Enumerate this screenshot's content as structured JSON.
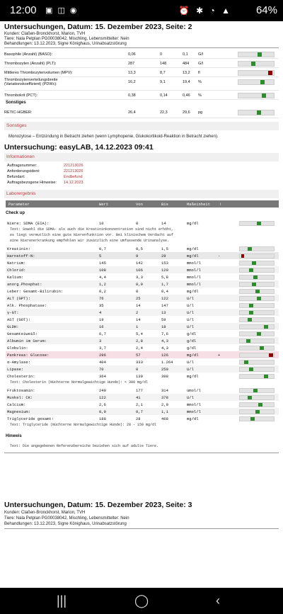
{
  "status": {
    "time": "12:00",
    "battery": "64%"
  },
  "page1": {
    "title": "Untersuchungen, Datum: 15. Dezember 2023, Seite: 2",
    "lines": [
      "Kunden: Claßen-Bronckhorst, Marion, TVH",
      "Tiere: Nala Petplan PG00038042, Mischling, Lebensmittelter: Nein",
      "Behandlungen: 13.12.2023, Signe Könighaus, Urinabsatzstörung"
    ]
  },
  "hema_rows": [
    {
      "name": "Basophile (Anzahl) (BASO):",
      "value": "0,06",
      "low": "0",
      "high": "0,1",
      "unit": "G/l",
      "marker": 0.62,
      "kind": "ok"
    },
    {
      "name": "Thrombozyten (Anzahl) (PLT):",
      "value": "287",
      "low": "148",
      "high": "484",
      "unit": "G/l",
      "marker": 0.42,
      "kind": "ok"
    },
    {
      "name": "Mittleres Thrombozytenvolumen (MPV):",
      "value": "13,3",
      "low": "8,7",
      "high": "13,2",
      "unit": "fl",
      "marker": 0.95,
      "kind": "hi"
    },
    {
      "name": "Thrombozytenverteilungsbreite (Variationskoeffizient) (PDWc):",
      "value": "16,2",
      "low": "9,1",
      "high": "19,4",
      "unit": "%",
      "marker": 0.7,
      "kind": "ok"
    },
    {
      "name": "Thrombokrit (PCT):",
      "value": "0,38",
      "low": "0,14",
      "high": "0,46",
      "unit": "%",
      "marker": 0.75,
      "kind": "ok"
    }
  ],
  "sonstiges_label": "Sonstiges",
  "retic": {
    "name": "RETIC-HGBER:",
    "value": "26,4",
    "low": "22,3",
    "high": "29,6",
    "unit": "pg",
    "marker": 0.6,
    "kind": "ok"
  },
  "sonstiges_band": "Sonstiges",
  "sonstiges_text": "Monozytose – Entzündung in Betracht ziehen (wenn Lymphopenie, Glukokortikoid-Reaktion in Betracht ziehen).",
  "easylab_title": "Untersuchung: easyLAB, 14.12.2023 09:41",
  "informationen_band": "Informationen",
  "info": [
    {
      "k": "Auftragsnummer:",
      "v": "221213026"
    },
    {
      "k": "Anforderungsident:",
      "v": "221213026"
    },
    {
      "k": "Befundart:",
      "v": "Endbefund"
    },
    {
      "k": "Auftragsbezogene Hinweise:",
      "v": "14.12.2023"
    }
  ],
  "laborergebnis_band": "Laborergebnis",
  "lab_head": {
    "param": "Parameter",
    "wert": "Wert",
    "von": "Von",
    "bis": "Bis",
    "einheit": "Maßeinheit",
    "flag": "!"
  },
  "checkup_label": "Check up",
  "lab_rows_a": [
    {
      "name": "Niere: SDMA (EIA):",
      "value": "10",
      "low": "0",
      "high": "14",
      "unit": "mg/dl",
      "marker": 0.55,
      "kind": "ok",
      "style": ""
    }
  ],
  "sdma_note": [
    "Text:  Sowohl die SDMA- als auch die Kreatininkonzentration sind nicht erhöht,",
    "es liegt vermutlich eine gute Nierenfunktion vor. Bei klinischem Verdacht auf",
    "eine Nierenerkrankung empfehlen wir zusätzlich eine umfassende Urinanalyse."
  ],
  "lab_rows_b": [
    {
      "name": "Kreatinin:",
      "value": "0,7",
      "low": "0,5",
      "high": "1,5",
      "unit": "mg/dl",
      "marker": 0.25,
      "kind": "ok",
      "style": ""
    },
    {
      "name": "Harnstoff-N:",
      "value": "5",
      "low": "9",
      "high": "29",
      "unit": "mg/dl",
      "flag": "-",
      "marker": 0.04,
      "kind": "lo",
      "style": "flag"
    },
    {
      "name": "Natrium:",
      "value": "145",
      "low": "142",
      "high": "153",
      "unit": "mmol/l",
      "marker": 0.4,
      "kind": "ok",
      "style": ""
    },
    {
      "name": "Chlorid:",
      "value": "108",
      "low": "106",
      "high": "120",
      "unit": "mmol/l",
      "marker": 0.3,
      "kind": "ok",
      "style": "alt"
    },
    {
      "name": "Kalium:",
      "value": "4,4",
      "low": "3,3",
      "high": "5,8",
      "unit": "mmol/l",
      "marker": 0.45,
      "kind": "ok",
      "style": ""
    },
    {
      "name": "anorg.Phosphat:",
      "value": "1,2",
      "low": "0,9",
      "high": "1,7",
      "unit": "mmol/l",
      "marker": 0.4,
      "kind": "ok",
      "style": "alt"
    },
    {
      "name": "Leber: Gesamt-Bilirubin:",
      "value": "0,2",
      "low": "0",
      "high": "0,4",
      "unit": "mg/dl",
      "marker": 0.5,
      "kind": "ok",
      "style": ""
    },
    {
      "name": "ALT (GPT):",
      "value": "76",
      "low": "25",
      "high": "122",
      "unit": "U/l",
      "marker": 0.55,
      "kind": "ok",
      "style": "alt"
    },
    {
      "name": "Alk. Phosphatase:",
      "value": "35",
      "low": "14",
      "high": "147",
      "unit": "U/l",
      "marker": 0.3,
      "kind": "ok",
      "style": ""
    },
    {
      "name": "γ-GT:",
      "value": "4",
      "low": "2",
      "high": "13",
      "unit": "U/l",
      "marker": 0.3,
      "kind": "ok",
      "style": "alt"
    },
    {
      "name": "AST (GOT):",
      "value": "19",
      "low": "14",
      "high": "59",
      "unit": "U/l",
      "marker": 0.25,
      "kind": "ok",
      "style": ""
    },
    {
      "name": "GLDH:",
      "value": "16",
      "low": "1",
      "high": "18",
      "unit": "U/l",
      "marker": 0.8,
      "kind": "ok",
      "style": "alt"
    },
    {
      "name": "Gesamteiweiß:",
      "value": "6,7",
      "low": "5,4",
      "high": "7,6",
      "unit": "g/dl",
      "marker": 0.55,
      "kind": "ok",
      "style": ""
    },
    {
      "name": "Albumin im Serum:",
      "value": "3",
      "low": "2,8",
      "high": "4,3",
      "unit": "g/dl",
      "marker": 0.2,
      "kind": "ok",
      "style": "alt"
    },
    {
      "name": "Globulin:",
      "value": "3,7",
      "low": "2,4",
      "high": "4,3",
      "unit": "g/dl",
      "marker": 0.65,
      "kind": "ok",
      "style": ""
    },
    {
      "name": "Pankreas: Glucose:",
      "value": "296",
      "low": "57",
      "high": "126",
      "unit": "mg/dl",
      "flag": "+",
      "marker": 0.96,
      "kind": "hi",
      "style": "flagp"
    },
    {
      "name": "α-Amylase:",
      "value": "404",
      "low": "333",
      "high": "1.264",
      "unit": "U/l",
      "marker": 0.15,
      "kind": "ok",
      "style": ""
    },
    {
      "name": "Lipase:",
      "value": "70",
      "low": "0",
      "high": "250",
      "unit": "U/l",
      "marker": 0.3,
      "kind": "ok",
      "style": "alt"
    },
    {
      "name": "Cholesterin:",
      "value": "364",
      "low": "139",
      "high": "398",
      "unit": "mg/dl",
      "marker": 0.8,
      "kind": "ok",
      "style": ""
    }
  ],
  "chol_note": "Text:  Cholesterin (Nüchterne Normalgewichtige Hunde): < 300 mg/dl",
  "lab_rows_c": [
    {
      "name": "Fruktosamin:",
      "value": "240",
      "low": "177",
      "high": "314",
      "unit": "umol/l",
      "marker": 0.45,
      "kind": "ok",
      "style": ""
    },
    {
      "name": "Muskel: CK:",
      "value": "122",
      "low": "41",
      "high": "378",
      "unit": "U/l",
      "marker": 0.25,
      "kind": "ok",
      "style": "alt"
    },
    {
      "name": "Calcium:",
      "value": "2,6",
      "low": "2,1",
      "high": "2,9",
      "unit": "mmol/l",
      "marker": 0.6,
      "kind": "ok",
      "style": ""
    },
    {
      "name": "Magnesium:",
      "value": "0,9",
      "low": "0,7",
      "high": "1,1",
      "unit": "mmol/l",
      "marker": 0.5,
      "kind": "ok",
      "style": "alt"
    },
    {
      "name": "Triglyceride gesamt:",
      "value": "188",
      "low": "28",
      "high": "468",
      "unit": "mg/dl",
      "marker": 0.35,
      "kind": "ok",
      "style": ""
    }
  ],
  "tri_note": "Text:  Triglyceride (Nüchterne Normalgewichtige Hunde): 28 - 150 mg/dl",
  "hinweis_label": "Hinweis",
  "hinweis_text": "Text:  Die angegebenen Referenzbereiche beziehen sich auf adulte Tiere.",
  "page2": {
    "title": "Untersuchungen, Datum: 15. Dezember 2023, Seite: 3",
    "lines": [
      "Kunden: Claßen-Bronckhorst, Marion, TVH",
      "Tiere: Nala Petplan PG00038042, Mischling, Lebensmittelter: Nein",
      "Behandlungen: 13.12.2023, Signe Könighaus, Urinabsatzstörung"
    ]
  }
}
